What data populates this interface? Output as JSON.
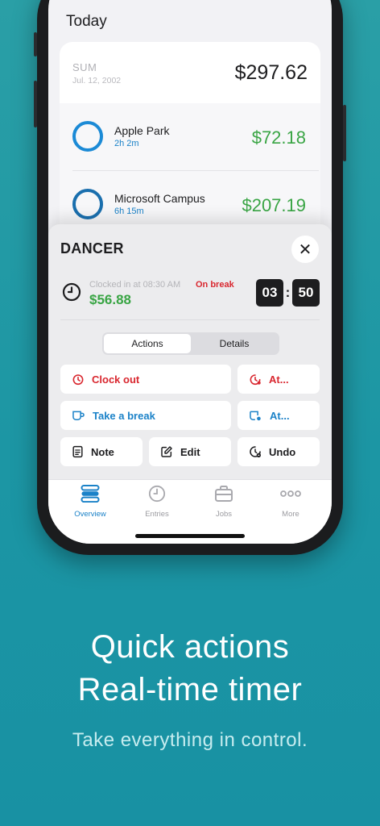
{
  "today": {
    "title": "Today",
    "sum_label": "SUM",
    "sum_date": "Jul. 12, 2002",
    "sum_amount": "$297.62"
  },
  "places": [
    {
      "name": "Apple Park",
      "duration": "2h 2m",
      "amount": "$72.18"
    },
    {
      "name": "Microsoft Campus",
      "duration": "6h 15m",
      "amount": "$207.19"
    }
  ],
  "sheet": {
    "job_title": "DANCER",
    "clocked_in": "Clocked in at 08:30 AM",
    "status": "On break",
    "earned": "$56.88",
    "timer_hours": "03",
    "timer_minutes": "50",
    "segments": [
      "Actions",
      "Details"
    ],
    "actions": {
      "clock_out": "Clock out",
      "clock_out_at": "At...",
      "take_break": "Take a break",
      "break_at": "At...",
      "note": "Note",
      "edit": "Edit",
      "undo": "Undo"
    }
  },
  "tabs": [
    {
      "label": "Overview",
      "icon": "overview-icon"
    },
    {
      "label": "Entries",
      "icon": "entries-icon"
    },
    {
      "label": "Jobs",
      "icon": "jobs-icon"
    },
    {
      "label": "More",
      "icon": "more-icon"
    }
  ],
  "caption": {
    "line1": "Quick actions",
    "line2": "Real-time timer",
    "subtitle": "Take everything in control."
  },
  "colors": {
    "background": "#1c96a4",
    "accent_blue": "#1b82c8",
    "money_green": "#3aa545",
    "alert_red": "#d9272f"
  }
}
